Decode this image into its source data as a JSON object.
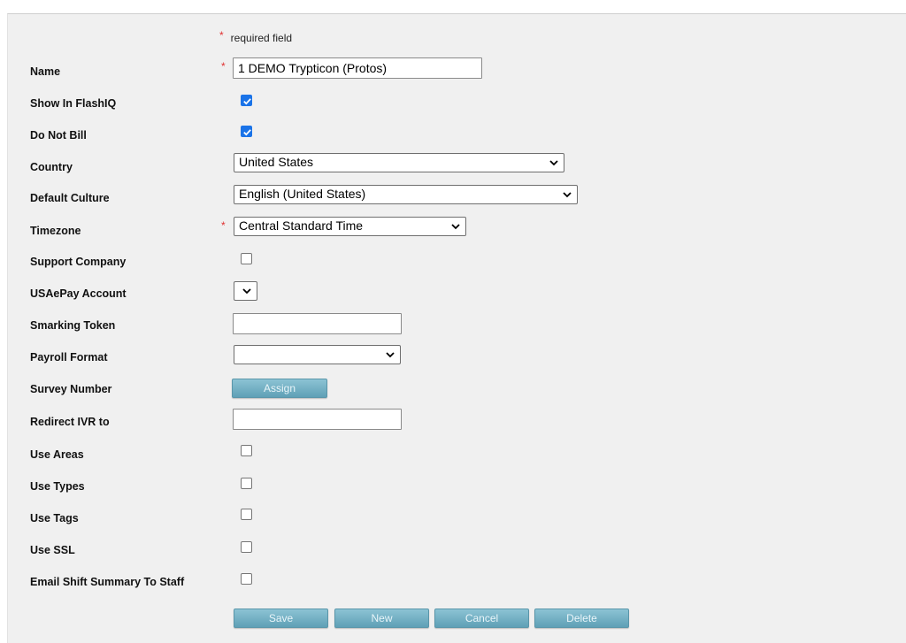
{
  "required_note": "required field",
  "required_star": "*",
  "fields": {
    "name": {
      "label": "Name",
      "value": "1 DEMO Trypticon (Protos)"
    },
    "show_in_flashiq": {
      "label": "Show In FlashIQ",
      "checked": true
    },
    "do_not_bill": {
      "label": "Do Not Bill",
      "checked": true
    },
    "country": {
      "label": "Country",
      "selected": "United States"
    },
    "default_culture": {
      "label": "Default Culture",
      "selected": "English (United States)"
    },
    "timezone": {
      "label": "Timezone",
      "selected": "Central Standard Time"
    },
    "support_company": {
      "label": "Support Company",
      "checked": false
    },
    "usaepay_account": {
      "label": "USAePay Account",
      "selected": ""
    },
    "smarking_token": {
      "label": "Smarking Token",
      "value": ""
    },
    "payroll_format": {
      "label": "Payroll Format",
      "selected": ""
    },
    "survey_number": {
      "label": "Survey Number",
      "button": "Assign"
    },
    "redirect_ivr": {
      "label": "Redirect IVR to",
      "value": ""
    },
    "use_areas": {
      "label": "Use Areas",
      "checked": false
    },
    "use_types": {
      "label": "Use Types",
      "checked": false
    },
    "use_tags": {
      "label": "Use Tags",
      "checked": false
    },
    "use_ssl": {
      "label": "Use SSL",
      "checked": false
    },
    "email_shift_summary": {
      "label": "Email Shift Summary To Staff",
      "checked": false
    }
  },
  "actions": {
    "save": "Save",
    "new": "New",
    "cancel": "Cancel",
    "delete": "Delete"
  },
  "colors": {
    "required": "#e03030",
    "checkbox_checked": "#1a73e8",
    "button": "#6eaec2",
    "panel_bg": "#f0f0f0"
  }
}
